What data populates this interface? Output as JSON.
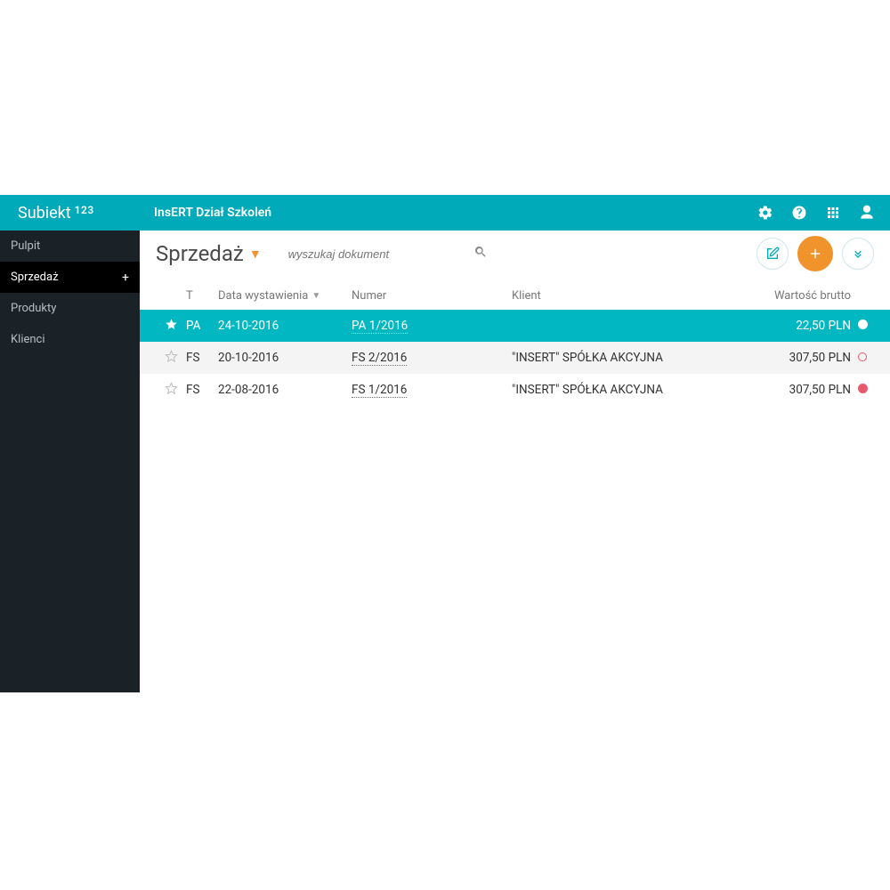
{
  "header": {
    "logo_main": "Subiekt",
    "logo_sup": "123",
    "org_name": "InsERT Dział Szkoleń"
  },
  "sidebar": {
    "items": [
      {
        "label": "Pulpit",
        "active": false
      },
      {
        "label": "Sprzedaż",
        "active": true,
        "has_plus": true
      },
      {
        "label": "Produkty",
        "active": false
      },
      {
        "label": "Klienci",
        "active": false
      }
    ]
  },
  "page": {
    "title": "Sprzedaż",
    "search_placeholder": "wyszukaj dokument"
  },
  "table": {
    "headers": {
      "t": "T",
      "date": "Data wystawienia",
      "number": "Numer",
      "client": "Klient",
      "amount": "Wartość brutto"
    },
    "rows": [
      {
        "starred": true,
        "type": "PA",
        "date": "24-10-2016",
        "number": "PA 1/2016",
        "client": "",
        "amount": "22,50 PLN",
        "status": "white",
        "selected": true
      },
      {
        "starred": false,
        "type": "FS",
        "date": "20-10-2016",
        "number": "FS 2/2016",
        "client": "\"INSERT\" SPÓŁKA AKCYJNA",
        "amount": "307,50 PLN",
        "status": "outline",
        "selected": false,
        "alt": true
      },
      {
        "starred": false,
        "type": "FS",
        "date": "22-08-2016",
        "number": "FS 1/2016",
        "client": "\"INSERT\" SPÓŁKA AKCYJNA",
        "amount": "307,50 PLN",
        "status": "pink",
        "selected": false
      }
    ]
  }
}
